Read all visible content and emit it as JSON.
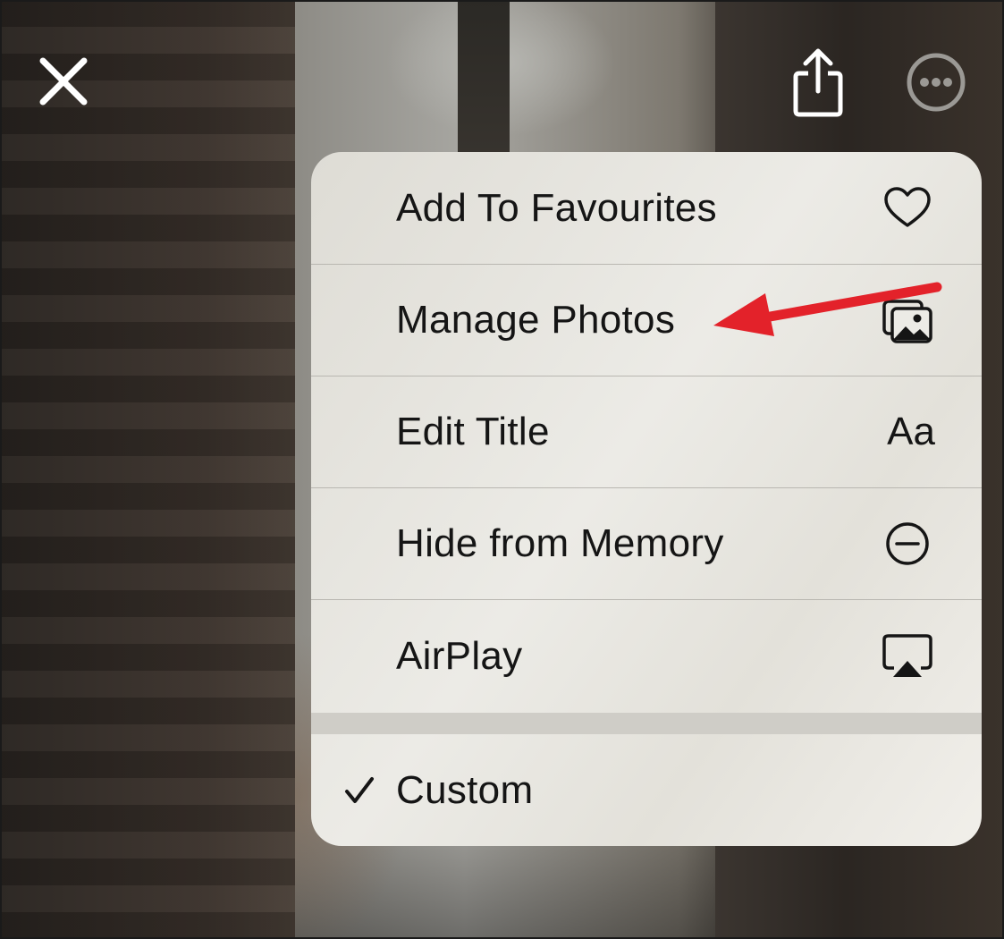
{
  "toolbar": {
    "close_icon": "close-icon",
    "share_icon": "share-icon",
    "more_icon": "ellipsis-circle-icon"
  },
  "menu": {
    "items": [
      {
        "label": "Add To Favourites",
        "icon": "heart-icon"
      },
      {
        "label": "Manage Photos",
        "icon": "photos-stack-icon"
      },
      {
        "label": "Edit Title",
        "icon_text": "Aa"
      },
      {
        "label": "Hide from Memory",
        "icon": "minus-circle-icon"
      },
      {
        "label": "AirPlay",
        "icon": "airplay-icon"
      }
    ],
    "selection": {
      "label": "Custom",
      "checked": true,
      "icon": "checkmark-icon"
    }
  },
  "colors": {
    "menu_background": "#ecebe6",
    "annotation_arrow": "#e3222a",
    "text": "#151515"
  }
}
